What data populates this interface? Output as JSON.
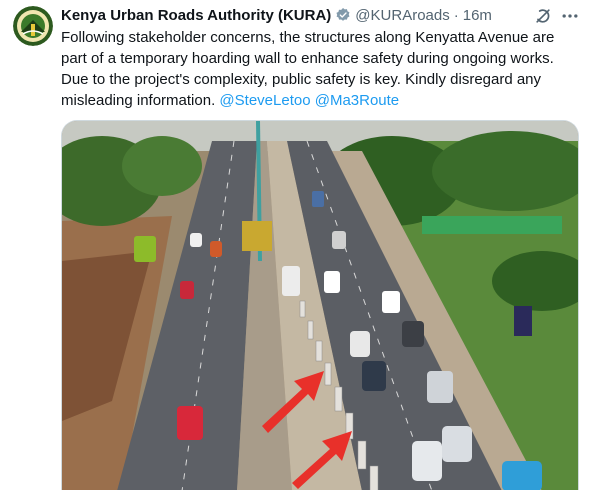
{
  "tweet": {
    "author_name": "Kenya Urban Roads Authority (KURA)",
    "handle": "@KURAroads",
    "separator": "·",
    "time": "16m",
    "text": "Following stakeholder concerns, the structures along Kenyatta Avenue are part of a temporary hoarding wall to enhance safety during ongoing works. Due to the project's complexity, public safety is key. Kindly disregard any misleading information.",
    "mentions": [
      "@SteveLetoo",
      "@Ma3Route"
    ],
    "verified": true
  },
  "icons": {
    "verified": "verified-badge-icon",
    "grok": "grok-icon",
    "more": "more-options-icon",
    "avatar": "kura-logo"
  },
  "colors": {
    "accent": "#1d9bf0",
    "verified_badge": "#829aab",
    "text": "#0f1419",
    "muted": "#536471",
    "arrow": "#e8302a"
  },
  "media": {
    "description_name": "aerial-photo-kenyatta-avenue"
  }
}
